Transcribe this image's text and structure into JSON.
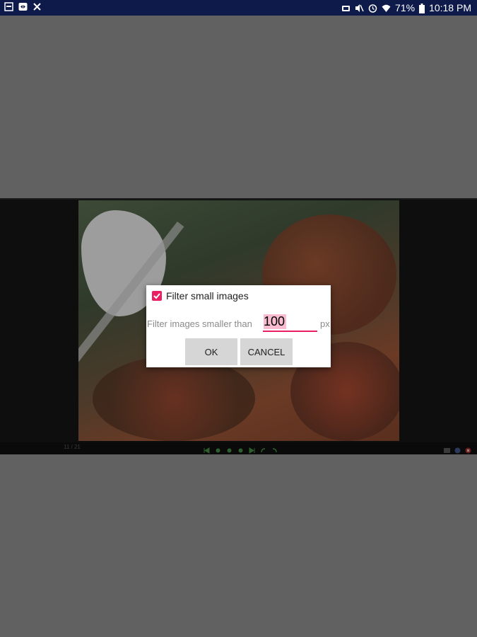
{
  "status_bar": {
    "left_icons": [
      "screenshot-icon",
      "vpn-icon",
      "notification-x-icon"
    ],
    "right_icons": [
      "nfc-icon",
      "mute-icon",
      "alarm-icon",
      "wifi-icon",
      "battery-icon"
    ],
    "battery": "71%",
    "time": "10:18 PM",
    "background": "#0d1a4a"
  },
  "viewer": {
    "counter": "11 / 21",
    "control_icons": [
      "first-icon",
      "prev-icon",
      "play-icon",
      "next-icon",
      "last-icon",
      "rotate-left-icon",
      "rotate-right-icon"
    ],
    "right_icons": [
      "gallery-icon",
      "info-icon",
      "close-icon"
    ]
  },
  "dialog": {
    "checkbox_label": "Filter small images",
    "checkbox_checked": true,
    "filter_label": "Filter images smaller than",
    "size_value": "100",
    "unit": "px",
    "ok_label": "OK",
    "cancel_label": "CANCEL",
    "accent": "#e91e63"
  }
}
